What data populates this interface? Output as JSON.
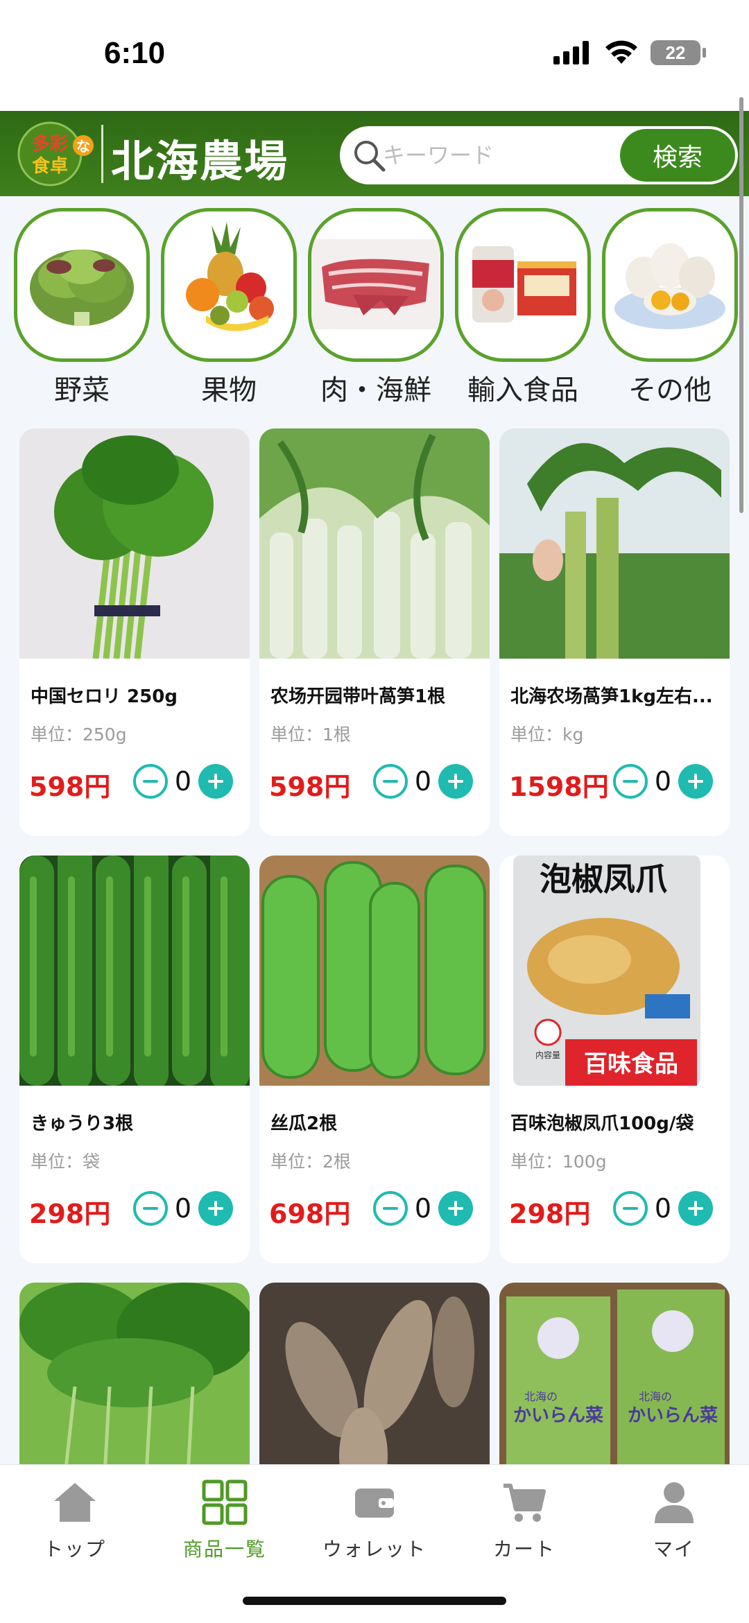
{
  "status_bar": {
    "time": "6:10",
    "battery": "22"
  },
  "header": {
    "logo_text_top": "多彩",
    "logo_text_bottom": "食卓",
    "logo_mark": "な",
    "title": "北海農場",
    "search_placeholder": "キーワード",
    "search_button": "検索"
  },
  "categories": [
    {
      "label": "野菜"
    },
    {
      "label": "果物"
    },
    {
      "label": "肉・海鮮"
    },
    {
      "label": "輸入食品"
    },
    {
      "label": "その他"
    }
  ],
  "products": [
    {
      "name": "中国セロリ 250g",
      "unit": "単位：250g",
      "price": "598円",
      "qty": "0"
    },
    {
      "name": "农场开园带叶萵笋1根",
      "unit": "単位：1根",
      "price": "598円",
      "qty": "0"
    },
    {
      "name": "北海农场萵笋1kg左右...",
      "unit": "単位：kg",
      "price": "1598円",
      "qty": "0"
    },
    {
      "name": "きゅうり3根",
      "unit": "単位：袋",
      "price": "298円",
      "qty": "0"
    },
    {
      "name": "丝瓜2根",
      "unit": "単位：2根",
      "price": "698円",
      "qty": "0"
    },
    {
      "name": "百味泡椒凤爪100g/袋",
      "unit": "単位：100g",
      "price": "298円",
      "qty": "0"
    }
  ],
  "product_images": {
    "pkg_title": "泡椒凤爪",
    "pkg_brand": "百味食品",
    "pkg_tag": "内容量",
    "bag_text": "かいらん菜",
    "bag_small": "北海の"
  },
  "bottom_nav": [
    {
      "label": "トップ"
    },
    {
      "label": "商品一覧"
    },
    {
      "label": "ウォレット"
    },
    {
      "label": "カート"
    },
    {
      "label": "マイ"
    }
  ],
  "colors": {
    "brand_green": "#3f7f1c",
    "accent_teal": "#1fbab0",
    "price_red": "#e21b1b"
  }
}
